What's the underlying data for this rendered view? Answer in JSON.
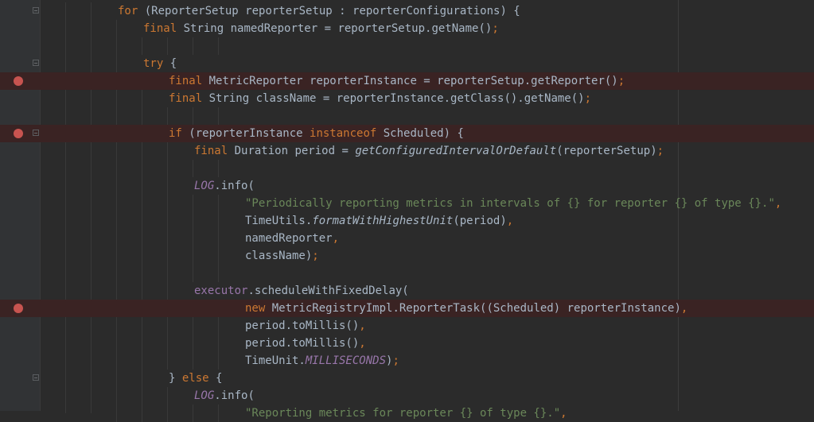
{
  "editor": {
    "colors": {
      "background": "#2b2b2b",
      "gutter": "#313335",
      "breakpoint": "#c75450",
      "breakpoint_line": "#3a2323",
      "keyword": "#cc7832",
      "string": "#6a8759",
      "plain": "#a9b7c6",
      "static_field": "#9876aa"
    },
    "lines": [
      {
        "indent": 3,
        "breakpoint": false,
        "fold": true,
        "tokens": [
          {
            "t": "for",
            "c": "kw"
          },
          {
            "t": " (ReporterSetup reporterSetup : reporterConfigurations) {"
          }
        ]
      },
      {
        "indent": 4,
        "breakpoint": false,
        "fold": false,
        "tokens": [
          {
            "t": "final",
            "c": "kw"
          },
          {
            "t": " String namedReporter = reporterSetup.getName()"
          },
          {
            "t": ";",
            "c": "cm"
          }
        ]
      },
      {
        "indent": 0,
        "breakpoint": false,
        "fold": false,
        "tokens": []
      },
      {
        "indent": 4,
        "breakpoint": false,
        "fold": true,
        "tokens": [
          {
            "t": "try",
            "c": "kw"
          },
          {
            "t": " {"
          }
        ]
      },
      {
        "indent": 5,
        "breakpoint": true,
        "fold": false,
        "tokens": [
          {
            "t": "final",
            "c": "kw"
          },
          {
            "t": " MetricReporter reporterInstance = reporterSetup.getReporter()"
          },
          {
            "t": ";",
            "c": "cm"
          }
        ]
      },
      {
        "indent": 5,
        "breakpoint": false,
        "fold": false,
        "tokens": [
          {
            "t": "final",
            "c": "kw"
          },
          {
            "t": " String className = reporterInstance.getClass().getName()"
          },
          {
            "t": ";",
            "c": "cm"
          }
        ]
      },
      {
        "indent": 0,
        "breakpoint": false,
        "fold": false,
        "tokens": []
      },
      {
        "indent": 5,
        "breakpoint": true,
        "fold": true,
        "tokens": [
          {
            "t": "if",
            "c": "kw"
          },
          {
            "t": " (reporterInstance "
          },
          {
            "t": "instanceof",
            "c": "kw"
          },
          {
            "t": " Scheduled) {"
          }
        ]
      },
      {
        "indent": 6,
        "breakpoint": false,
        "fold": false,
        "tokens": [
          {
            "t": "final",
            "c": "kw"
          },
          {
            "t": " Duration period = "
          },
          {
            "t": "getConfiguredIntervalOrDefault",
            "c": "it"
          },
          {
            "t": "(reporterSetup)"
          },
          {
            "t": ";",
            "c": "cm"
          }
        ]
      },
      {
        "indent": 0,
        "breakpoint": false,
        "fold": false,
        "tokens": []
      },
      {
        "indent": 6,
        "breakpoint": false,
        "fold": false,
        "tokens": [
          {
            "t": "LOG",
            "c": "pu it"
          },
          {
            "t": ".info("
          }
        ]
      },
      {
        "indent": 8,
        "breakpoint": false,
        "fold": false,
        "tokens": [
          {
            "t": "\"Periodically reporting metrics in intervals of {} for reporter {} of type {}.\"",
            "c": "st"
          },
          {
            "t": ",",
            "c": "cm"
          }
        ]
      },
      {
        "indent": 8,
        "breakpoint": false,
        "fold": false,
        "tokens": [
          {
            "t": "TimeUtils."
          },
          {
            "t": "formatWithHighestUnit",
            "c": "it"
          },
          {
            "t": "(period)"
          },
          {
            "t": ",",
            "c": "cm"
          }
        ]
      },
      {
        "indent": 8,
        "breakpoint": false,
        "fold": false,
        "tokens": [
          {
            "t": "namedReporter"
          },
          {
            "t": ",",
            "c": "cm"
          }
        ]
      },
      {
        "indent": 8,
        "breakpoint": false,
        "fold": false,
        "tokens": [
          {
            "t": "className)"
          },
          {
            "t": ";",
            "c": "cm"
          }
        ]
      },
      {
        "indent": 0,
        "breakpoint": false,
        "fold": false,
        "tokens": []
      },
      {
        "indent": 6,
        "breakpoint": false,
        "fold": false,
        "tokens": [
          {
            "t": "executor",
            "c": "pu"
          },
          {
            "t": ".scheduleWithFixedDelay("
          }
        ]
      },
      {
        "indent": 8,
        "breakpoint": true,
        "fold": false,
        "tokens": [
          {
            "t": "new",
            "c": "kw"
          },
          {
            "t": " MetricRegistryImpl.ReporterTask((Scheduled) reporterInstance)"
          },
          {
            "t": ",",
            "c": "cm"
          }
        ]
      },
      {
        "indent": 8,
        "breakpoint": false,
        "fold": false,
        "tokens": [
          {
            "t": "period.toMillis()"
          },
          {
            "t": ",",
            "c": "cm"
          }
        ]
      },
      {
        "indent": 8,
        "breakpoint": false,
        "fold": false,
        "tokens": [
          {
            "t": "period.toMillis()"
          },
          {
            "t": ",",
            "c": "cm"
          }
        ]
      },
      {
        "indent": 8,
        "breakpoint": false,
        "fold": false,
        "tokens": [
          {
            "t": "TimeUnit."
          },
          {
            "t": "MILLISECONDS",
            "c": "pu it"
          },
          {
            "t": ")"
          },
          {
            "t": ";",
            "c": "cm"
          }
        ]
      },
      {
        "indent": 5,
        "breakpoint": false,
        "fold": true,
        "tokens": [
          {
            "t": "} "
          },
          {
            "t": "else",
            "c": "kw"
          },
          {
            "t": " {"
          }
        ]
      },
      {
        "indent": 6,
        "breakpoint": false,
        "fold": false,
        "tokens": [
          {
            "t": "LOG",
            "c": "pu it"
          },
          {
            "t": ".info("
          }
        ]
      },
      {
        "indent": 8,
        "breakpoint": false,
        "fold": false,
        "tokens": [
          {
            "t": "\"Reporting metrics for reporter {} of type {}.\"",
            "c": "st"
          },
          {
            "t": ",",
            "c": "cm"
          }
        ]
      }
    ]
  }
}
